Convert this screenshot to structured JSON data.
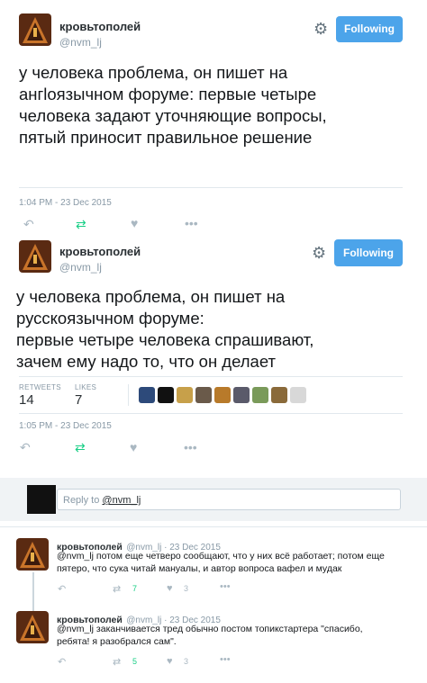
{
  "tweet1": {
    "display_name": "кровьтополей",
    "handle": "@nvm_lj",
    "follow_label": "Following",
    "text": "у человека проблема, он пишет на\nангloязычном форуме: первые четыре\nчеловека задают уточняющие вопросы,\nпятый приносит правильное решение",
    "timestamp": "1:04 PM - 23 Dec 2015"
  },
  "tweet2": {
    "display_name": "кровьтополей",
    "handle": "@nvm_lj",
    "follow_label": "Following",
    "text": "у человека проблема, он пишет на\nрусскоязычном форуме:\nпервые четыре человека спрашивают,\nзачем ему надо то, что он делает",
    "retweets_label": "RETWEETS",
    "retweets_count": "14",
    "likes_label": "LIKES",
    "likes_count": "7",
    "timestamp": "1:05 PM - 23 Dec 2015"
  },
  "reply_box": {
    "prefix": "Reply to ",
    "mention": "@nvm_lj"
  },
  "replies": [
    {
      "display_name": "кровьтополей",
      "meta": "@nvm_lj · 23 Dec 2015",
      "line1": "@nvm_lj потом еще четверо сообщают, что у них всё работает; потом еще",
      "line2": "пятеро, что сука читай мануалы, и автор вопроса вафел и мудак",
      "retweets": "7",
      "likes": "3"
    },
    {
      "display_name": "кровьтополей",
      "meta": "@nvm_lj · 23 Dec 2015",
      "line1": "@nvm_lj заканчивается тред обычно постом топикстартера \"спасибо,",
      "line2": "ребята! я разобрался сам\".",
      "retweets": "5",
      "likes": "3"
    }
  ],
  "icons": {
    "reply": "reply-icon",
    "retweet": "retweet-icon",
    "like": "heart-icon",
    "more": "more-icon",
    "settings": "gear-icon"
  },
  "colors": {
    "follow_button": "#4ca4ea",
    "retweet_green": "#19cf86",
    "muted": "#8899a6"
  }
}
